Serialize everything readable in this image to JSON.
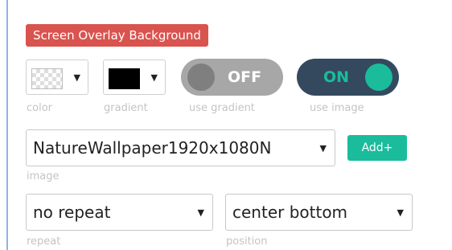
{
  "section": {
    "title": "Screen Overlay Background"
  },
  "color_picker": {
    "caption": "color",
    "swatch": "transparent-checker",
    "caret_icon": "caret-down-icon"
  },
  "gradient_picker": {
    "caption": "gradient",
    "swatch_color": "#000000",
    "caret_icon": "caret-down-icon"
  },
  "use_gradient": {
    "label": "OFF",
    "caption": "use gradient",
    "state": "off",
    "track_color": "#a7a7a7"
  },
  "use_image": {
    "label": "ON",
    "caption": "use image",
    "state": "on",
    "track_color": "#34495e",
    "accent_color": "#1abc9c"
  },
  "image": {
    "value": "NatureWallpaper1920x1080N",
    "caption": "image",
    "add_label": "Add+"
  },
  "repeat": {
    "value": "no repeat",
    "caption": "repeat"
  },
  "position": {
    "value": "center bottom",
    "caption": "position"
  },
  "colors": {
    "badge": "#d9534f",
    "accent": "#1abc9c",
    "dark": "#34495e",
    "caption": "#c4c4c4"
  }
}
